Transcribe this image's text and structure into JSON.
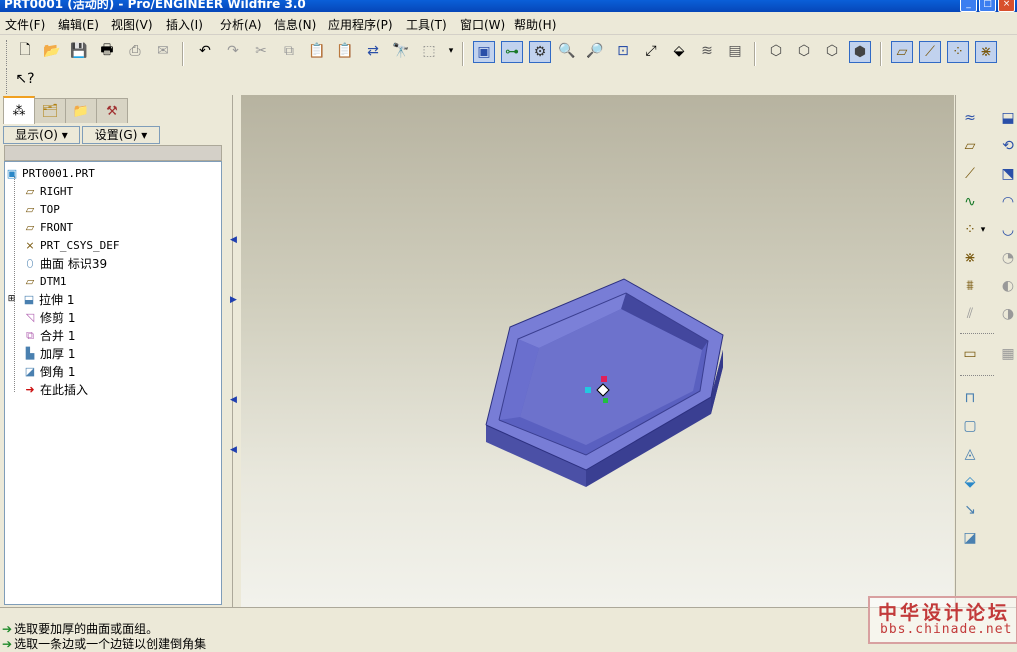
{
  "window": {
    "title": "PRT0001 (活动的) - Pro/ENGINEER Wildfire 3.0"
  },
  "menu": [
    "文件(F)",
    "编辑(E)",
    "视图(V)",
    "插入(I)",
    "分析(A)",
    "信息(N)",
    "应用程序(P)",
    "工具(T)",
    "窗口(W)",
    "帮助(H)"
  ],
  "panel": {
    "show_button": "显示(O) ▾",
    "settings_button": "设置(G) ▾"
  },
  "tree": [
    {
      "icon": "part-icon",
      "label": "PRT0001.PRT"
    },
    {
      "icon": "datum-plane-icon",
      "label": "RIGHT"
    },
    {
      "icon": "datum-plane-icon",
      "label": "TOP"
    },
    {
      "icon": "datum-plane-icon",
      "label": "FRONT"
    },
    {
      "icon": "coordinate-system-icon",
      "label": "PRT_CSYS_DEF"
    },
    {
      "icon": "surface-icon",
      "label": "曲面 标识39"
    },
    {
      "icon": "datum-plane-icon",
      "label": "DTM1"
    },
    {
      "icon": "extrude-icon",
      "label": "拉伸 1"
    },
    {
      "icon": "trim-icon",
      "label": "修剪 1"
    },
    {
      "icon": "merge-icon",
      "label": "合并 1"
    },
    {
      "icon": "thicken-icon",
      "label": "加厚 1"
    },
    {
      "icon": "chamfer-icon",
      "label": "倒角 1"
    },
    {
      "icon": "insert-here-icon",
      "label": "在此插入"
    }
  ],
  "status": {
    "line1": "选取要加厚的曲面或面组。",
    "line2": "选取一条边或一个边链以创建倒角集"
  },
  "watermark": {
    "line1": "中华设计论坛",
    "line2": "bbs.chinade.net"
  },
  "colors": {
    "model": "#6d72cc",
    "title_bar": "#0a5fd8",
    "insert_arrow": "#cc1111"
  }
}
